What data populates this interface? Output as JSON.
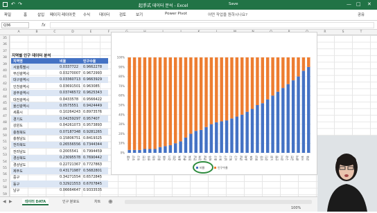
{
  "app": {
    "title": "起手式 데이터 분석 - Excel",
    "save_status": "Save"
  },
  "ribbon": {
    "tabs": [
      "파일",
      "홈",
      "삽입",
      "페이지 레이아웃",
      "수식",
      "데이터",
      "검토",
      "보기",
      "Power Pivot",
      "어떤 작업을 원하시나요?"
    ],
    "share": "공유"
  },
  "formula": {
    "name_box": "Q36",
    "value": ""
  },
  "columns": [
    "A",
    "B",
    "C",
    "D",
    "E",
    "F",
    "G",
    "H",
    "I",
    "J",
    "K",
    "L",
    "M",
    "N",
    "O",
    "P",
    "Q",
    "R",
    "S",
    "T"
  ],
  "rows": [
    "35",
    "36",
    "37",
    "38",
    "39",
    "40",
    "41",
    "42",
    "43",
    "44",
    "45",
    "46",
    "47",
    "48",
    "49",
    "50",
    "51",
    "52",
    "53",
    "54",
    "55",
    "56",
    "57",
    "58",
    "59"
  ],
  "table": {
    "title": "지역별 인구 데이터 분석",
    "headers": [
      "지역명",
      "비율",
      "인구수율"
    ],
    "rows": [
      [
        "서울특별시",
        "0.0337722",
        "0.9662278"
      ],
      [
        "부산광역시",
        "0.03270007",
        "0.9672993"
      ],
      [
        "대구광역시",
        "0.03360713",
        "0.9663929"
      ],
      [
        "인천광역시",
        "0.03691501",
        "0.963085"
      ],
      [
        "광주광역시",
        "0.03746572",
        "0.9625343"
      ],
      [
        "대전광역시",
        "0.0433578",
        "0.9566422"
      ],
      [
        "울산광역시",
        "0.0575551",
        "0.9424449"
      ],
      [
        "세종시",
        "0.10264243",
        "0.8973576"
      ],
      [
        "경기도",
        "0.04259297",
        "0.957407"
      ],
      [
        "강원도",
        "0.04261073",
        "0.9573893"
      ],
      [
        "충청북도",
        "0.07187348",
        "0.9281265"
      ],
      [
        "충청남도",
        "0.15806751",
        "0.8419325"
      ],
      [
        "전라북도",
        "0.26556556",
        "0.7344344"
      ],
      [
        "전라남도",
        "0.2005541",
        "0.7994459"
      ],
      [
        "경상북도",
        "0.23095578",
        "0.7690442"
      ],
      [
        "경상남도",
        "0.22721367",
        "0.7727863"
      ],
      [
        "제주도",
        "0.43171987",
        "0.5682801"
      ],
      [
        "중구",
        "0.34271554",
        "0.6572845"
      ],
      [
        "동구",
        "0.32921553",
        "0.6707845"
      ],
      [
        "남구",
        "0.06664647",
        "0.9333535"
      ]
    ]
  },
  "chart_data": {
    "type": "bar",
    "stacked": true,
    "percent_axis": true,
    "yticks": [
      "0%",
      "10%",
      "20%",
      "30%",
      "40%",
      "50%",
      "60%",
      "70%",
      "80%",
      "90%",
      "100%"
    ],
    "series": [
      {
        "name": "비율",
        "color": "#4472c4",
        "values": [
          0.03,
          0.03,
          0.03,
          0.04,
          0.04,
          0.04,
          0.06,
          0.07,
          0.08,
          0.1,
          0.12,
          0.16,
          0.2,
          0.23,
          0.24,
          0.27,
          0.3,
          0.32,
          0.33,
          0.34,
          0.36,
          0.38,
          0.4,
          0.43,
          0.46,
          0.5,
          0.52,
          0.56,
          0.6,
          0.64,
          0.68,
          0.72,
          0.76,
          0.8,
          0.86,
          0.9
        ]
      },
      {
        "name": "인구수율",
        "color": "#ed7d31",
        "values": [
          0.97,
          0.97,
          0.97,
          0.96,
          0.96,
          0.96,
          0.94,
          0.93,
          0.92,
          0.9,
          0.88,
          0.84,
          0.8,
          0.77,
          0.76,
          0.73,
          0.7,
          0.68,
          0.67,
          0.66,
          0.64,
          0.62,
          0.6,
          0.57,
          0.54,
          0.5,
          0.48,
          0.44,
          0.4,
          0.36,
          0.32,
          0.28,
          0.24,
          0.2,
          0.14,
          0.1
        ]
      }
    ],
    "categories": [
      "서울",
      "부산",
      "대구",
      "인천",
      "광주",
      "대전",
      "울산",
      "세종",
      "경기",
      "강원",
      "충북",
      "충남",
      "전북",
      "전남",
      "경북",
      "경남",
      "제주",
      "중구",
      "동구",
      "남구",
      "북구",
      "서구",
      "강남",
      "송파",
      "마포",
      "용산",
      "성동",
      "광진",
      "노원",
      "은평",
      "강서",
      "구로",
      "금천",
      "관악",
      "서초",
      "강동"
    ],
    "legend": [
      "비율",
      "인구수율"
    ],
    "legend_position": "bottom"
  },
  "sheets": [
    "데이터 DATA",
    "인구 분포도",
    "차트"
  ],
  "status": {
    "zoom": "100%"
  }
}
